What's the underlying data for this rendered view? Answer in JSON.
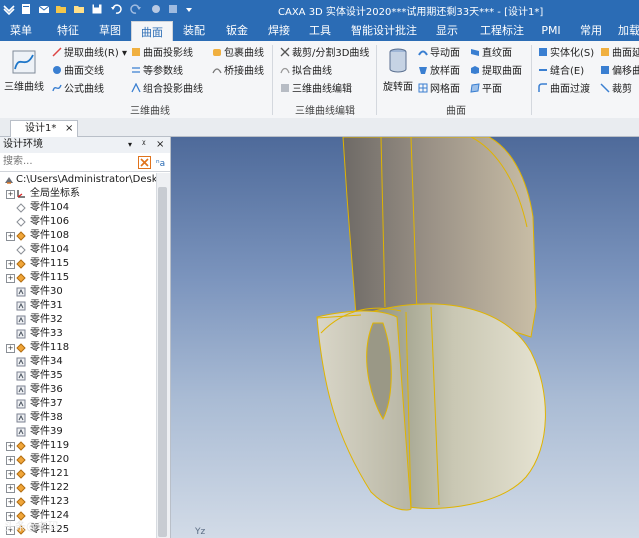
{
  "window": {
    "title": "CAXA 3D 实体设计2020***试用期还剩33天*** - [设计1*]"
  },
  "menu_tabs": [
    {
      "label": "菜单",
      "active": false
    },
    {
      "label": "特征",
      "active": false
    },
    {
      "label": "草图",
      "active": false
    },
    {
      "label": "曲面",
      "active": true
    },
    {
      "label": "装配",
      "active": false
    },
    {
      "label": "钣金",
      "active": false
    },
    {
      "label": "焊接",
      "active": false
    },
    {
      "label": "工具",
      "active": false
    },
    {
      "label": "智能设计批注",
      "active": false
    },
    {
      "label": "显示",
      "active": false
    },
    {
      "label": "工程标注",
      "active": false
    },
    {
      "label": "PMI",
      "active": false
    },
    {
      "label": "常用",
      "active": false
    },
    {
      "label": "加载",
      "active": false
    }
  ],
  "ribbon": {
    "big_3d_curve": "三维曲线",
    "col1": [
      "提取曲线(R)",
      "曲面交线",
      "公式曲线"
    ],
    "col2": [
      "曲面投影线",
      "等参数线",
      "组合投影曲线"
    ],
    "col3": [
      "包裹曲线",
      "桥接曲线"
    ],
    "group1": "三维曲线",
    "col4": [
      "裁剪/分割3D曲线",
      "拟合曲线",
      "三维曲线编辑"
    ],
    "group2": "三维曲线编辑",
    "big_revolve": "旋转面",
    "col5": [
      "导动面",
      "放样面",
      "网格面"
    ],
    "col6": [
      "直纹面",
      "提取曲面",
      "平面"
    ],
    "group3": "曲面",
    "col7": [
      "实体化(S)",
      "缝合(E)",
      "曲面过渡"
    ],
    "col8": [
      "曲面延",
      "偏移曲",
      "裁剪"
    ]
  },
  "doc_tab": {
    "label": "设计1*",
    "close": "×"
  },
  "panel": {
    "title": "设计环境",
    "pin": "ᵡ",
    "close": "×",
    "search_placeholder": "搜索...",
    "tree": [
      {
        "label": "C:\\Users\\Administrator\\Deskto",
        "icon": "root-icon",
        "expand": "",
        "depth": 0
      },
      {
        "label": "全局坐标系",
        "icon": "coordinate-system-icon",
        "expand": "+",
        "depth": 1
      },
      {
        "label": "零件104",
        "icon": "hidden-part-icon",
        "expand": "",
        "depth": 1
      },
      {
        "label": "零件106",
        "icon": "hidden-part-icon",
        "expand": "",
        "depth": 1
      },
      {
        "label": "零件108",
        "icon": "part-icon",
        "expand": "+",
        "depth": 1
      },
      {
        "label": "零件104",
        "icon": "hidden-part-icon",
        "expand": "",
        "depth": 1
      },
      {
        "label": "零件115",
        "icon": "part-icon",
        "expand": "+",
        "depth": 1
      },
      {
        "label": "零件115",
        "icon": "part-icon",
        "expand": "+",
        "depth": 1
      },
      {
        "label": "零件30",
        "icon": "surface-part-icon",
        "expand": "",
        "depth": 1
      },
      {
        "label": "零件31",
        "icon": "surface-part-icon",
        "expand": "",
        "depth": 1
      },
      {
        "label": "零件32",
        "icon": "surface-part-icon",
        "expand": "",
        "depth": 1
      },
      {
        "label": "零件33",
        "icon": "surface-part-icon",
        "expand": "",
        "depth": 1
      },
      {
        "label": "零件118",
        "icon": "part-icon",
        "expand": "+",
        "depth": 1
      },
      {
        "label": "零件34",
        "icon": "surface-part-icon",
        "expand": "",
        "depth": 1
      },
      {
        "label": "零件35",
        "icon": "surface-part-icon",
        "expand": "",
        "depth": 1
      },
      {
        "label": "零件36",
        "icon": "surface-part-icon",
        "expand": "",
        "depth": 1
      },
      {
        "label": "零件37",
        "icon": "surface-part-icon",
        "expand": "",
        "depth": 1
      },
      {
        "label": "零件38",
        "icon": "surface-part-icon",
        "expand": "",
        "depth": 1
      },
      {
        "label": "零件39",
        "icon": "surface-part-icon",
        "expand": "",
        "depth": 1
      },
      {
        "label": "零件119",
        "icon": "part-icon",
        "expand": "+",
        "depth": 1
      },
      {
        "label": "零件120",
        "icon": "part-icon",
        "expand": "+",
        "depth": 1
      },
      {
        "label": "零件121",
        "icon": "part-icon",
        "expand": "+",
        "depth": 1
      },
      {
        "label": "零件122",
        "icon": "part-icon",
        "expand": "+",
        "depth": 1
      },
      {
        "label": "零件123",
        "icon": "part-icon",
        "expand": "+",
        "depth": 1
      },
      {
        "label": "零件124",
        "icon": "part-icon",
        "expand": "+",
        "depth": 1
      },
      {
        "label": "零件125",
        "icon": "part-icon",
        "expand": "+",
        "depth": 1
      }
    ]
  },
  "watermark": "头条@老码",
  "viewport_axis_label": "Yz"
}
